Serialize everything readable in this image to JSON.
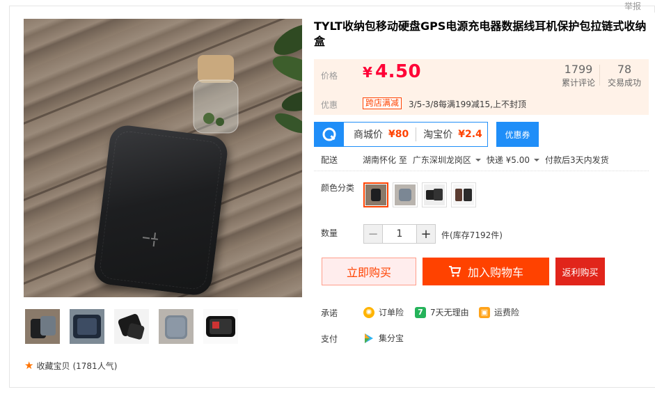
{
  "report_link": "举报",
  "product": {
    "title": "TYLT收纳包移动硬盘GPS电源充电器数据线耳机保护包拉链式收纳盒"
  },
  "price": {
    "label": "价格",
    "currency": "¥",
    "value": "4.50",
    "reviews_count": "1799",
    "reviews_label": "累计评论",
    "deals_count": "78",
    "deals_label": "交易成功",
    "promo_label": "优惠",
    "promo_tag": "跨店满减",
    "promo_text": "3/5-3/8每满199减15,上不封顶"
  },
  "compare": {
    "mall_label": "商城价",
    "mall_price": "¥80",
    "taobao_label": "淘宝价",
    "taobao_price": "¥2.4",
    "coupon_button": "优惠券"
  },
  "shipping": {
    "label": "配送",
    "from": "湖南怀化 至",
    "to": "广东深圳龙岗区",
    "method": "快递 ¥5.00",
    "dispatch": "付款后3天内发货"
  },
  "options": {
    "color_label": "颜色分类",
    "selected_index": 0
  },
  "quantity": {
    "label": "数量",
    "minus": "−",
    "value": "1",
    "plus": "+",
    "stock_text": "件(库存7192件)"
  },
  "actions": {
    "buy_now": "立即购买",
    "add_to_cart": "加入购物车",
    "rebate_buy": "返利购买"
  },
  "guarantee": {
    "label": "承诺",
    "items": [
      "订单险",
      "7天无理由",
      "运费险"
    ]
  },
  "payment": {
    "label": "支付",
    "method": "集分宝"
  },
  "favorite": {
    "text": "收藏宝贝",
    "popularity": "(1781人气)"
  },
  "colors": {
    "accent": "#ff4200",
    "price_red": "#ff0036",
    "blue": "#1f8ef8",
    "price_bg": "#fff2e8"
  }
}
